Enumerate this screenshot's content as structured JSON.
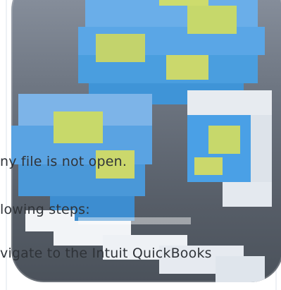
{
  "icon": {
    "name": "globe-magnifier-icon",
    "colors": {
      "tile_top": "#8b93a0",
      "tile_bottom": "#4b525b",
      "globe_blue": "#4aa0e6",
      "globe_green": "#c8d96a",
      "lens_white": "#f2f4f7"
    }
  },
  "text_lines": [
    "ny file is not open.",
    "lowing steps:",
    "vigate to the Intuit QuickBooks"
  ]
}
